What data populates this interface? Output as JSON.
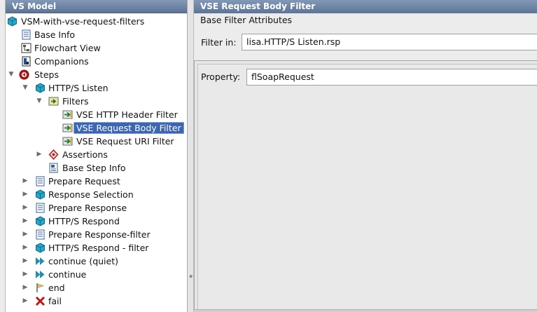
{
  "left_panel": {
    "title": "VS Model",
    "tree": [
      {
        "label": "VSM-with-vse-request-filters",
        "icon": "cube-icon"
      },
      {
        "label": "Base Info",
        "icon": "document-icon"
      },
      {
        "label": "Flowchart View",
        "icon": "flowchart-icon"
      },
      {
        "label": "Companions",
        "icon": "companions-icon"
      },
      {
        "label": "Steps",
        "icon": "steps-icon"
      },
      {
        "label": "HTTP/S Listen",
        "icon": "cube-icon"
      },
      {
        "label": "Filters",
        "icon": "filter-icon"
      },
      {
        "label": "VSE HTTP Header Filter",
        "icon": "filter-item-icon"
      },
      {
        "label": "VSE Request Body Filter",
        "icon": "filter-item-icon",
        "selected": true
      },
      {
        "label": "VSE Request URI Filter",
        "icon": "filter-item-icon"
      },
      {
        "label": "Assertions",
        "icon": "assertion-icon"
      },
      {
        "label": "Base Step Info",
        "icon": "step-info-icon"
      },
      {
        "label": "Prepare Request",
        "icon": "document-icon"
      },
      {
        "label": "Response Selection",
        "icon": "cube-icon"
      },
      {
        "label": "Prepare Response",
        "icon": "document-icon"
      },
      {
        "label": "HTTP/S Respond",
        "icon": "cube-icon"
      },
      {
        "label": "Prepare Response-filter",
        "icon": "document-icon"
      },
      {
        "label": "HTTP/S Respond - filter",
        "icon": "cube-icon"
      },
      {
        "label": "continue (quiet)",
        "icon": "fast-forward-icon"
      },
      {
        "label": "continue",
        "icon": "fast-forward-icon"
      },
      {
        "label": "end",
        "icon": "flag-icon"
      },
      {
        "label": "fail",
        "icon": "fail-x-icon"
      }
    ]
  },
  "right_panel": {
    "title": "VSE Request Body Filter",
    "section_label": "Base Filter Attributes",
    "filter_in": {
      "label": "Filter in:",
      "value": "lisa.HTTP/S Listen.rsp"
    },
    "property": {
      "label": "Property:",
      "value": "flSoapRequest"
    }
  }
}
